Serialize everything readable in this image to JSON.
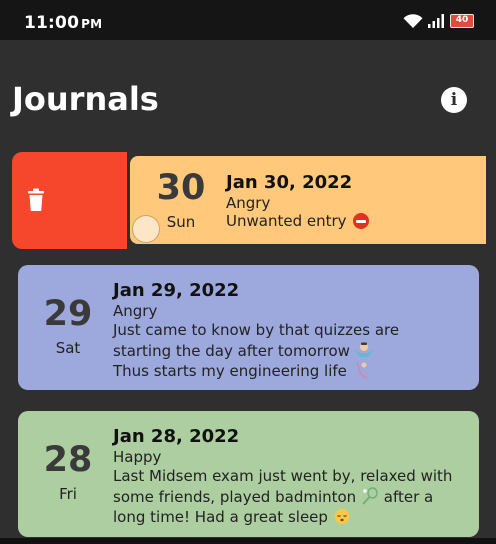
{
  "status_bar": {
    "time": "11:00",
    "ampm": "PM",
    "battery": "40"
  },
  "header": {
    "title": "Journals",
    "info_icon": "info-icon"
  },
  "swipe_action": {
    "icon": "trash-icon",
    "color": "#f6462b"
  },
  "entries": [
    {
      "day": "30",
      "weekday": "Sun",
      "date": "Jan 30, 2022",
      "mood": "Angry",
      "lines": [
        "Unwanted entry"
      ],
      "color": "#ffc87a"
    },
    {
      "day": "29",
      "weekday": "Sat",
      "date": "Jan 29, 2022",
      "mood": "Angry",
      "lines": [
        "Just came to know by that quizzes are",
        "starting the day after tomorrow",
        "Thus starts my engineering life"
      ],
      "color": "#9da9dd"
    },
    {
      "day": "28",
      "weekday": "Fri",
      "date": "Jan 28, 2022",
      "mood": "Happy",
      "lines": [
        "Last Midsem exam just went by, relaxed with",
        "some friends, played badminton",
        "after a",
        "long time! Had a great sleep"
      ],
      "color": "#adcea0"
    }
  ]
}
